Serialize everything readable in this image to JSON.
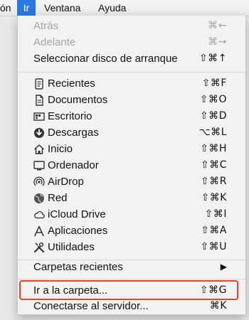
{
  "menubar": {
    "items": [
      "ón",
      "Ir",
      "Ventana",
      "Ayuda"
    ]
  },
  "menu": {
    "back": {
      "label": "Atrás",
      "shortcut": "⌘←"
    },
    "forward": {
      "label": "Adelante",
      "shortcut": "⌘→"
    },
    "startup_disk": {
      "label": "Seleccionar disco de arranque",
      "shortcut": "⇧⌘↑"
    },
    "places": [
      {
        "label": "Recientes",
        "shortcut": "⇧⌘F",
        "icon": "recents-icon"
      },
      {
        "label": "Documentos",
        "shortcut": "⇧⌘O",
        "icon": "documents-icon"
      },
      {
        "label": "Escritorio",
        "shortcut": "⇧⌘D",
        "icon": "desktop-icon"
      },
      {
        "label": "Descargas",
        "shortcut": "⌥⌘L",
        "icon": "downloads-icon"
      },
      {
        "label": "Inicio",
        "shortcut": "⇧⌘H",
        "icon": "home-icon"
      },
      {
        "label": "Ordenador",
        "shortcut": "⇧⌘C",
        "icon": "computer-icon"
      },
      {
        "label": "AirDrop",
        "shortcut": "⇧⌘R",
        "icon": "airdrop-icon"
      },
      {
        "label": "Red",
        "shortcut": "⇧⌘K",
        "icon": "network-icon"
      },
      {
        "label": "iCloud Drive",
        "shortcut": "⇧⌘I",
        "icon": "icloud-icon"
      },
      {
        "label": "Aplicaciones",
        "shortcut": "⇧⌘A",
        "icon": "applications-icon"
      },
      {
        "label": "Utilidades",
        "shortcut": "⇧⌘U",
        "icon": "utilities-icon"
      }
    ],
    "recent_folders": {
      "label": "Carpetas recientes",
      "arrow": "▶"
    },
    "go_to_folder": {
      "label": "Ir a la carpeta...",
      "shortcut": "⇧⌘G"
    },
    "connect_server": {
      "label": "Conectarse al servidor...",
      "shortcut": "⌘K"
    }
  },
  "colors": {
    "menubar_highlight": "#2a78e4",
    "callout_border": "#e0452f"
  }
}
